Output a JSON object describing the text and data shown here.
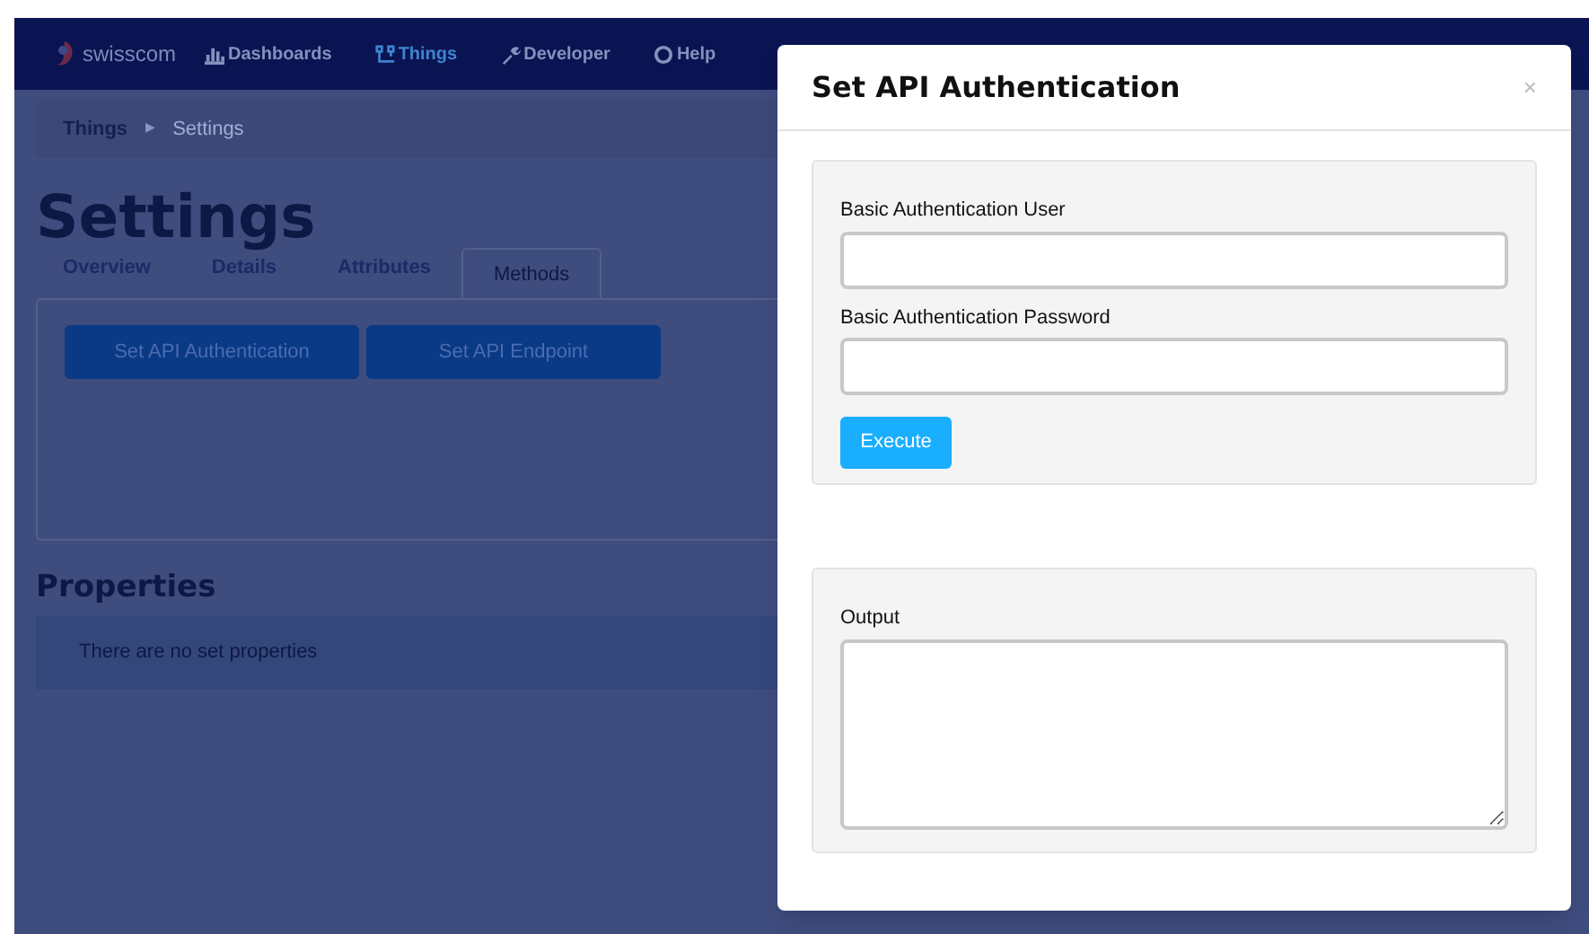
{
  "nav": {
    "brand": "swisscom",
    "items": [
      {
        "label": "Dashboards",
        "selected": false
      },
      {
        "label": "Things",
        "selected": true
      },
      {
        "label": "Developer",
        "selected": false
      },
      {
        "label": "Help",
        "selected": false
      }
    ]
  },
  "breadcrumb": {
    "separator": "▶",
    "items": [
      "Things",
      "Settings"
    ]
  },
  "page_title": "Settings",
  "tabs": [
    {
      "label": "Overview",
      "selected": false
    },
    {
      "label": "Details",
      "selected": false
    },
    {
      "label": "Attributes",
      "selected": false
    },
    {
      "label": "Methods",
      "selected": true
    }
  ],
  "method_buttons": [
    "Set API Authentication",
    "Set API Endpoint"
  ],
  "properties": {
    "title": "Properties",
    "empty_text": "There are no set properties"
  },
  "modal": {
    "title": "Set API Authentication",
    "close": "×",
    "fields": [
      {
        "label": "Basic Authentication User"
      },
      {
        "label": "Basic Authentication Password"
      }
    ],
    "execute_button": "Execute",
    "output": {
      "label": "Output"
    }
  }
}
